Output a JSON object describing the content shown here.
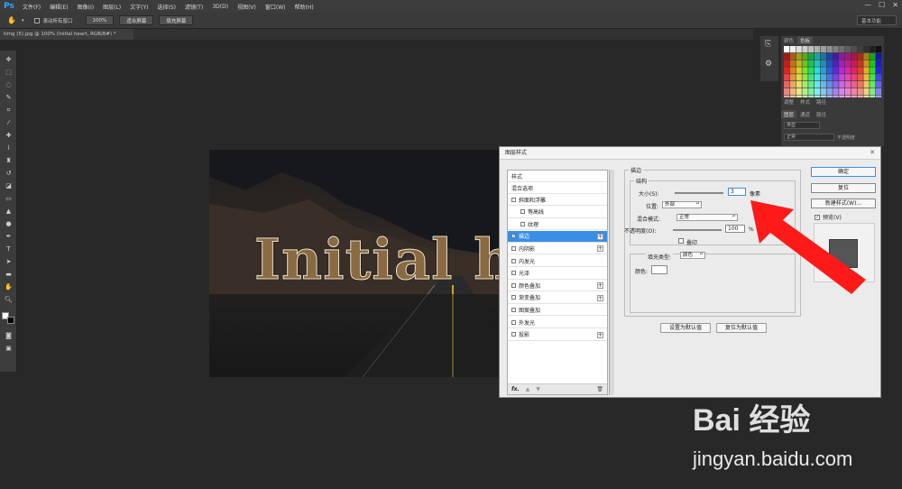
{
  "app": {
    "logo": "Ps"
  },
  "menu": [
    "文件(F)",
    "编辑(E)",
    "图像(I)",
    "图层(L)",
    "文字(Y)",
    "选择(S)",
    "滤镜(T)",
    "3D(D)",
    "视图(V)",
    "窗口(W)",
    "帮助(H)"
  ],
  "window_controls": {
    "minimize": "—",
    "maximize": "☐",
    "close": "✕"
  },
  "options_bar": {
    "scroll_all_windows": "滚动所有窗口",
    "zoom_100": "100%",
    "fit_screen": "适合屏幕",
    "fill_screen": "填充屏幕",
    "workspace": "基本功能"
  },
  "document_tab": "timg (5).jpg @ 100% (Initial heart, RGB/8#) *",
  "canvas_text": "Initial h",
  "panels": {
    "swatch_tabs": [
      "颜色",
      "色板"
    ],
    "adjust_tabs": [
      "调整",
      "样式",
      "路径"
    ],
    "layer_tabs": [
      "图层",
      "通道",
      "路径"
    ],
    "kind_filter": "类型",
    "blend_mode": "正常",
    "opacity_label": "不透明度"
  },
  "dialog": {
    "title": "图层样式",
    "styles_header": "样式",
    "blend_options": "混合选项",
    "items": [
      {
        "label": "斜面和浮雕",
        "checked": false,
        "sub": false,
        "plus": false
      },
      {
        "label": "等高线",
        "checked": false,
        "sub": true,
        "plus": false
      },
      {
        "label": "纹理",
        "checked": false,
        "sub": true,
        "plus": false
      },
      {
        "label": "描边",
        "checked": true,
        "sub": false,
        "plus": true,
        "selected": true
      },
      {
        "label": "内阴影",
        "checked": false,
        "sub": false,
        "plus": true
      },
      {
        "label": "内发光",
        "checked": false,
        "sub": false,
        "plus": false
      },
      {
        "label": "光泽",
        "checked": false,
        "sub": false,
        "plus": false
      },
      {
        "label": "颜色叠加",
        "checked": false,
        "sub": false,
        "plus": true
      },
      {
        "label": "渐变叠加",
        "checked": false,
        "sub": false,
        "plus": true
      },
      {
        "label": "图案叠加",
        "checked": false,
        "sub": false,
        "plus": false
      },
      {
        "label": "外发光",
        "checked": false,
        "sub": false,
        "plus": false
      },
      {
        "label": "投影",
        "checked": false,
        "sub": false,
        "plus": true
      }
    ],
    "footer_fx": "fx.",
    "stroke": {
      "section_title": "描边",
      "structure_title": "结构",
      "size_label": "大小(S):",
      "size_value": "3",
      "size_unit": "像素",
      "position_label": "位置:",
      "position_value": "外部",
      "blend_label": "混合模式:",
      "blend_value": "正常",
      "opacity_label": "不透明度(O):",
      "opacity_value": "100",
      "opacity_unit": "%",
      "overprint_label": "叠印",
      "fill_type_label": "填充类型:",
      "fill_type_value": "颜色",
      "color_label": "颜色:",
      "make_default": "设置为默认值",
      "reset_default": "复位为默认值"
    },
    "buttons": {
      "ok": "确定",
      "reset": "复位",
      "new_style": "新建样式(W)...",
      "preview": "预览(V)"
    }
  },
  "watermark": {
    "brand": "Bai 经验",
    "url": "jingyan.baidu.com"
  }
}
